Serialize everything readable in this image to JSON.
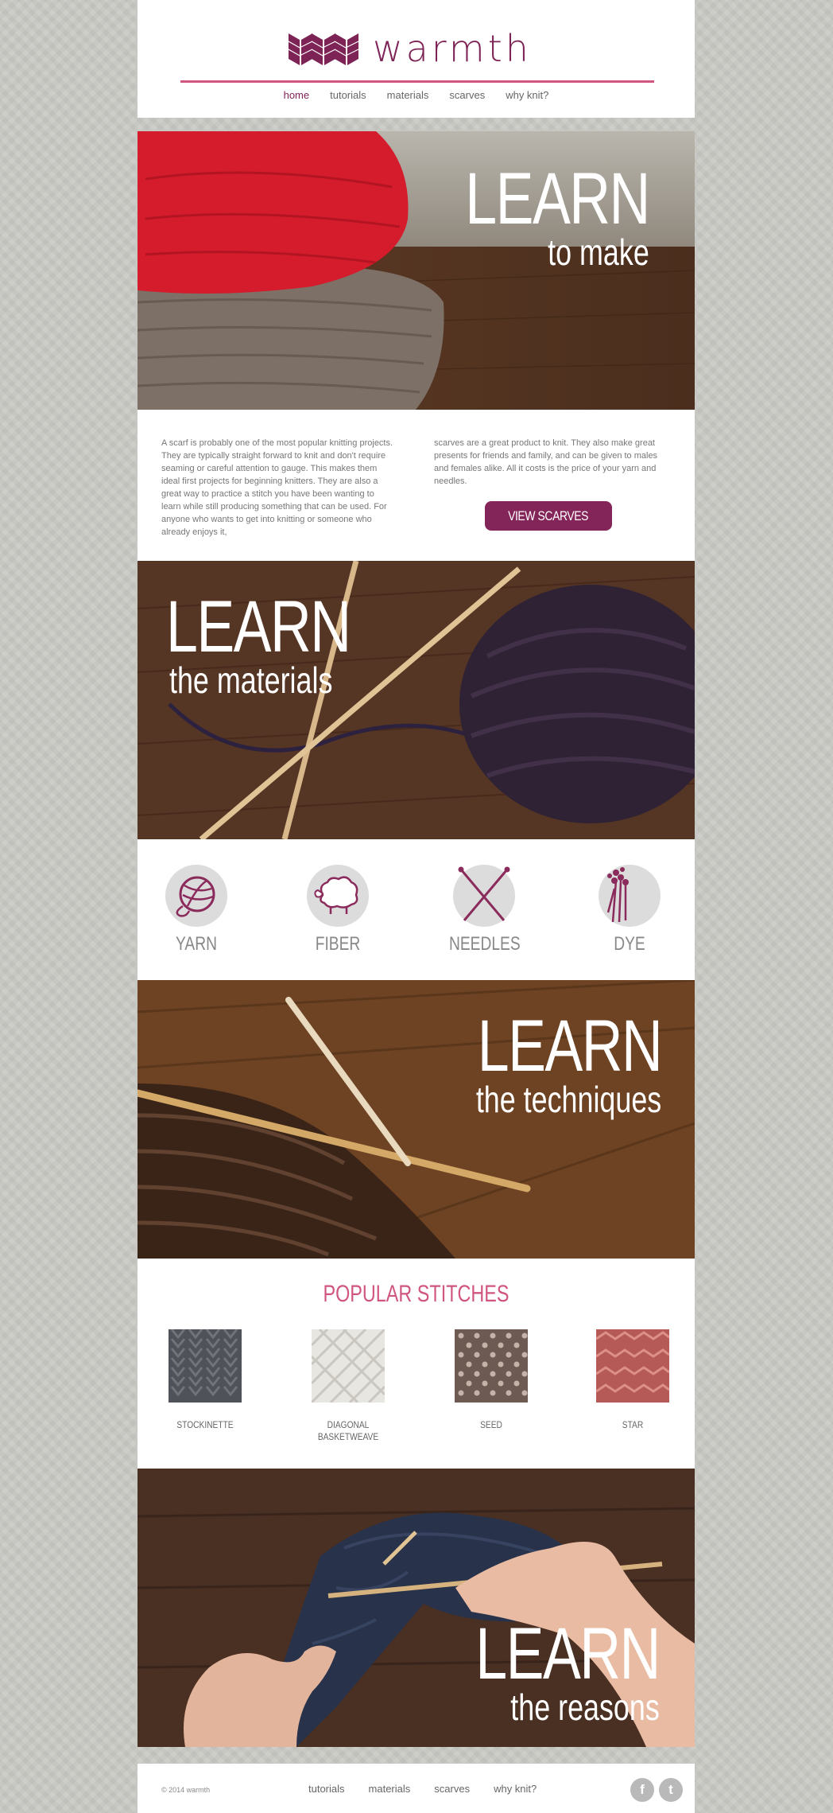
{
  "header": {
    "logo_text": "warmth",
    "nav": [
      {
        "label": "home",
        "active": true
      },
      {
        "label": "tutorials"
      },
      {
        "label": "materials"
      },
      {
        "label": "scarves"
      },
      {
        "label": "why knit?"
      }
    ]
  },
  "heroes": [
    {
      "learn": "LEARN",
      "sub": "to make"
    },
    {
      "learn": "LEARN",
      "sub": "the materials"
    },
    {
      "learn": "LEARN",
      "sub": "the techniques"
    },
    {
      "learn": "LEARN",
      "sub": "the reasons"
    }
  ],
  "intro": {
    "left_text": "A scarf is probably one of the most popular knitting projects. They are typically straight forward to knit and don't require seaming or careful attention to gauge. This makes them ideal first projects for beginning knitters. They are also a great way to practice a stitch you have been wanting to learn while still producing something that can be used. For anyone who wants to get into knitting or someone who already enjoys it,",
    "right_text": "scarves are a great product to knit. They also make great presents for friends and family, and can be given to males and females alike. All it costs is the price of your yarn and needles.",
    "button_label": "VIEW SCARVES"
  },
  "materials": [
    {
      "label": "YARN",
      "icon": "yarn-ball-icon"
    },
    {
      "label": "FIBER",
      "icon": "sheep-icon"
    },
    {
      "label": "NEEDLES",
      "icon": "crossed-needles-icon"
    },
    {
      "label": "DYE",
      "icon": "flower-bouquet-icon"
    }
  ],
  "stitches": {
    "title": "POPULAR STITCHES",
    "items": [
      {
        "label": "STOCKINETTE",
        "color": "#4f5258"
      },
      {
        "label": "DIAGONAL BASKETWEAVE",
        "color": "#e7e6e1"
      },
      {
        "label": "SEED",
        "color": "#6d5a52"
      },
      {
        "label": "STAR",
        "color": "#b55a57"
      }
    ]
  },
  "footer": {
    "copyright": "© 2014 warmth",
    "nav": [
      "tutorials",
      "materials",
      "scarves",
      "why knit?"
    ],
    "social": [
      {
        "icon": "facebook-icon",
        "glyph": "f"
      },
      {
        "icon": "twitter-icon",
        "glyph": "t"
      }
    ]
  },
  "colors": {
    "brand": "#7e2356",
    "accent": "#d0557f",
    "button": "#842559"
  }
}
